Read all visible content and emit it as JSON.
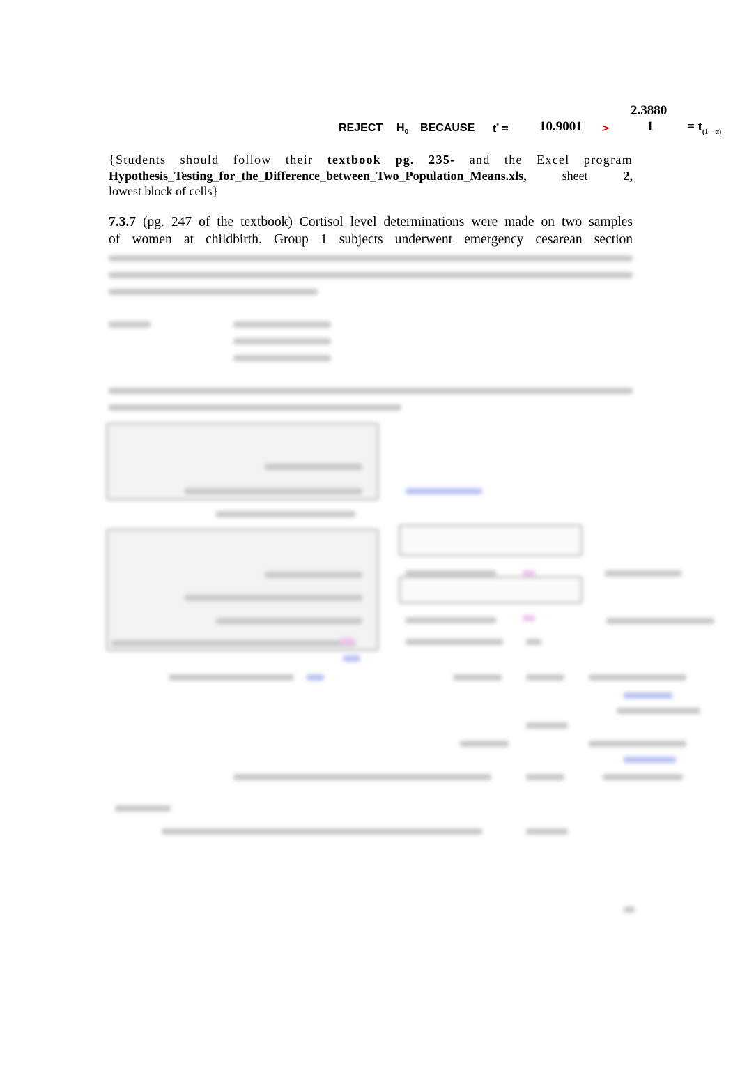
{
  "conclusion": {
    "reject": "REJECT",
    "h": "H",
    "h_sub": "0",
    "because": "BECAUSE",
    "t": "t",
    "t_sup": "*",
    "equals": "=",
    "t_star_value": "10.9001",
    "greater": ">",
    "t_crit_line1": "2.3880",
    "t_crit_line2": "1",
    "t_crit_label": "= t",
    "t_crit_sub": "(1 – α)"
  },
  "note": {
    "line1_a": "{Students should follow their ",
    "line1_bold": "textbook pg. 235-",
    "line1_b": " and the Excel program",
    "filename": "Hypothesis_Testing_for_the_Difference_between_Two_Population_Means.xls,",
    "sheet": "sheet",
    "sheet_no": "2,",
    "line3": "lowest block of cells}"
  },
  "problem": {
    "number": "7.3.7",
    "text_line1": " (pg. 247 of the textbook) Cortisol level determinations were made on two samples",
    "text_line2": "of women at childbirth. Group 1 subjects underwent emergency cesarean section"
  },
  "colors": {
    "red": "#e00000",
    "blurred_link": "#b8c2f2",
    "blurred_highlight": "#f0c2f0"
  }
}
